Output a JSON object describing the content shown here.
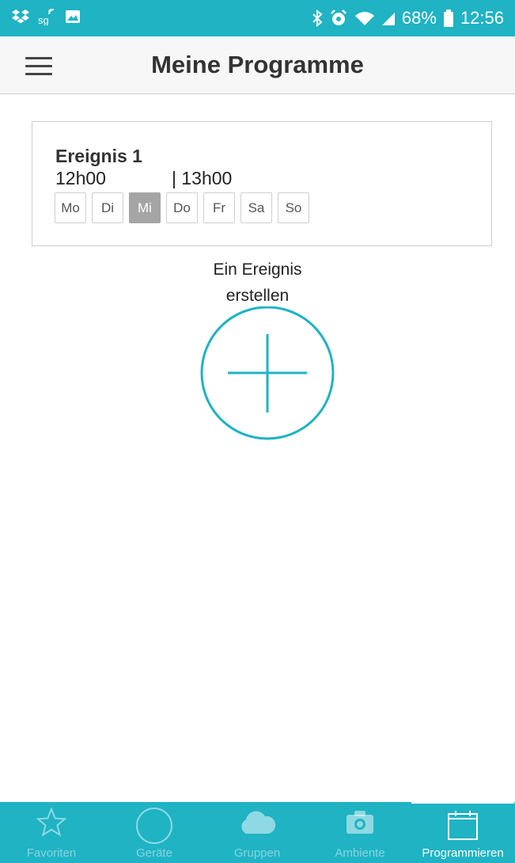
{
  "status_bar": {
    "battery_percent": "68%",
    "time": "12:56",
    "left_icons": [
      "dropbox-icon",
      "sg-icon",
      "image-icon"
    ],
    "right_icons": [
      "bluetooth-icon",
      "alarm-icon",
      "wifi-icon",
      "signal-icon",
      "battery-icon"
    ]
  },
  "header": {
    "title": "Meine Programme",
    "menu_icon": "hamburger-menu-icon"
  },
  "event": {
    "title": "Ereignis 1",
    "start": "12h00",
    "end": "| 13h00",
    "days": [
      {
        "label": "Mo",
        "active": false
      },
      {
        "label": "Di",
        "active": false
      },
      {
        "label": "Mi",
        "active": true
      },
      {
        "label": "Do",
        "active": false
      },
      {
        "label": "Fr",
        "active": false
      },
      {
        "label": "Sa",
        "active": false
      },
      {
        "label": "So",
        "active": false
      }
    ]
  },
  "create": {
    "line1": "Ein Ereignis",
    "line2": "erstellen",
    "icon": "add-circle-icon"
  },
  "nav": [
    {
      "label": "Favoriten",
      "icon": "star-icon",
      "active": false
    },
    {
      "label": "Geräte",
      "icon": "circle-icon",
      "active": false
    },
    {
      "label": "Gruppen",
      "icon": "cloud-icon",
      "active": false
    },
    {
      "label": "Ambiente",
      "icon": "camera-icon",
      "active": false
    },
    {
      "label": "Programmieren",
      "icon": "calendar-icon",
      "active": true
    }
  ],
  "colors": {
    "accent": "#1fb3c4",
    "active_day": "#a5a5a5"
  }
}
